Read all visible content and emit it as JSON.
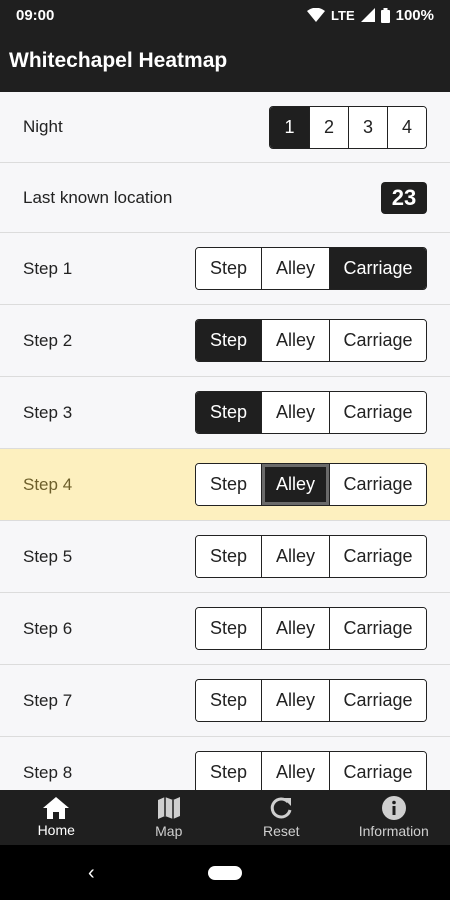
{
  "status": {
    "time": "09:00",
    "network": "LTE",
    "battery": "100%"
  },
  "app": {
    "title": "Whitechapel Heatmap"
  },
  "night": {
    "label": "Night",
    "options": [
      "1",
      "2",
      "3",
      "4"
    ],
    "selected": "1"
  },
  "location": {
    "label": "Last known location",
    "value": "23"
  },
  "step_options": [
    "Step",
    "Alley",
    "Carriage"
  ],
  "steps": [
    {
      "label": "Step 1",
      "selected": "Carriage"
    },
    {
      "label": "Step 2",
      "selected": "Step"
    },
    {
      "label": "Step 3",
      "selected": "Step"
    },
    {
      "label": "Step 4",
      "selected": "Alley",
      "highlighted": true
    },
    {
      "label": "Step 5",
      "selected": ""
    },
    {
      "label": "Step 6",
      "selected": ""
    },
    {
      "label": "Step 7",
      "selected": ""
    },
    {
      "label": "Step 8",
      "selected": ""
    }
  ],
  "bottom_nav": [
    {
      "label": "Home",
      "icon": "home-icon",
      "active": true
    },
    {
      "label": "Map",
      "icon": "map-icon",
      "active": false
    },
    {
      "label": "Reset",
      "icon": "reset-icon",
      "active": false
    },
    {
      "label": "Information",
      "icon": "info-icon",
      "active": false
    }
  ],
  "system_nav": {
    "back_icon": "‹"
  },
  "colors": {
    "bar": "#1f1f1f",
    "highlight": "#fdf0bf",
    "background": "#f7f7f9"
  }
}
